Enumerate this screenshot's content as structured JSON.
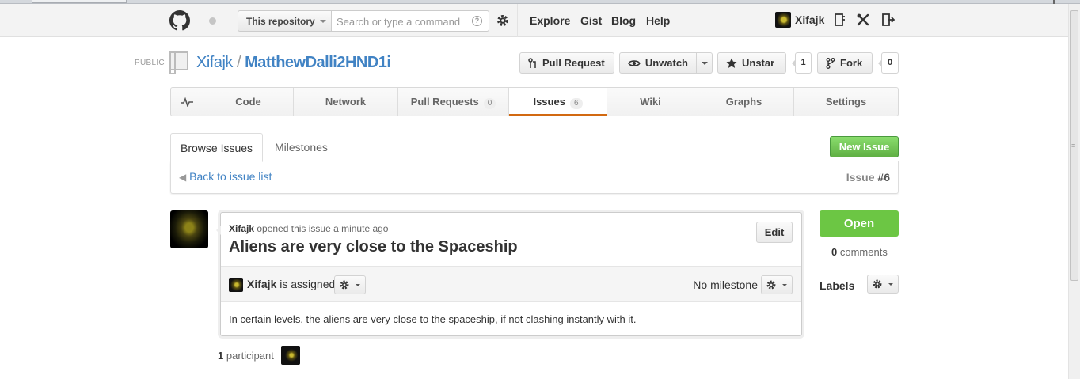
{
  "header": {
    "scope_label": "This repository",
    "search_placeholder": "Search or type a command",
    "nav": [
      {
        "label": "Explore"
      },
      {
        "label": "Gist"
      },
      {
        "label": "Blog"
      },
      {
        "label": "Help"
      }
    ],
    "username": "Xifajk"
  },
  "repo": {
    "visibility": "PUBLIC",
    "owner": "Xifajk",
    "separator": "/",
    "name": "MatthewDalli2HND1i",
    "actions": {
      "pull_request": "Pull Request",
      "unwatch": "Unwatch",
      "unstar": "Unstar",
      "star_count": "1",
      "fork": "Fork",
      "fork_count": "0"
    }
  },
  "repo_nav": {
    "tabs": [
      {
        "label": "Code"
      },
      {
        "label": "Network"
      },
      {
        "label": "Pull Requests",
        "count": "0"
      },
      {
        "label": "Issues",
        "count": "6",
        "selected": true
      },
      {
        "label": "Wiki"
      },
      {
        "label": "Graphs"
      },
      {
        "label": "Settings"
      }
    ]
  },
  "issues_nav": {
    "tabs": [
      {
        "label": "Browse Issues",
        "active": true
      },
      {
        "label": "Milestones"
      }
    ],
    "new_issue": "New Issue",
    "back_link": "Back to issue list",
    "issue_label": "Issue",
    "issue_number": "#6"
  },
  "issue": {
    "author": "Xifajk",
    "opened_text": "opened this issue a minute ago",
    "title": "Aliens are very close to the Spaceship",
    "edit_label": "Edit",
    "assignee": "Xifajk",
    "assigned_text": "is assigned",
    "milestone": "No milestone",
    "body": "In certain levels, the aliens are very close to the spaceship, if not clashing instantly with it.",
    "status": "Open",
    "comment_count": "0",
    "comments_label": "comments",
    "labels_title": "Labels",
    "participant_count": "1",
    "participants_label": "participant"
  },
  "colors": {
    "link": "#4183c4",
    "open_green": "#6cc644",
    "new_issue_green": "#60b044",
    "selected_tab_underline": "#d26911"
  }
}
